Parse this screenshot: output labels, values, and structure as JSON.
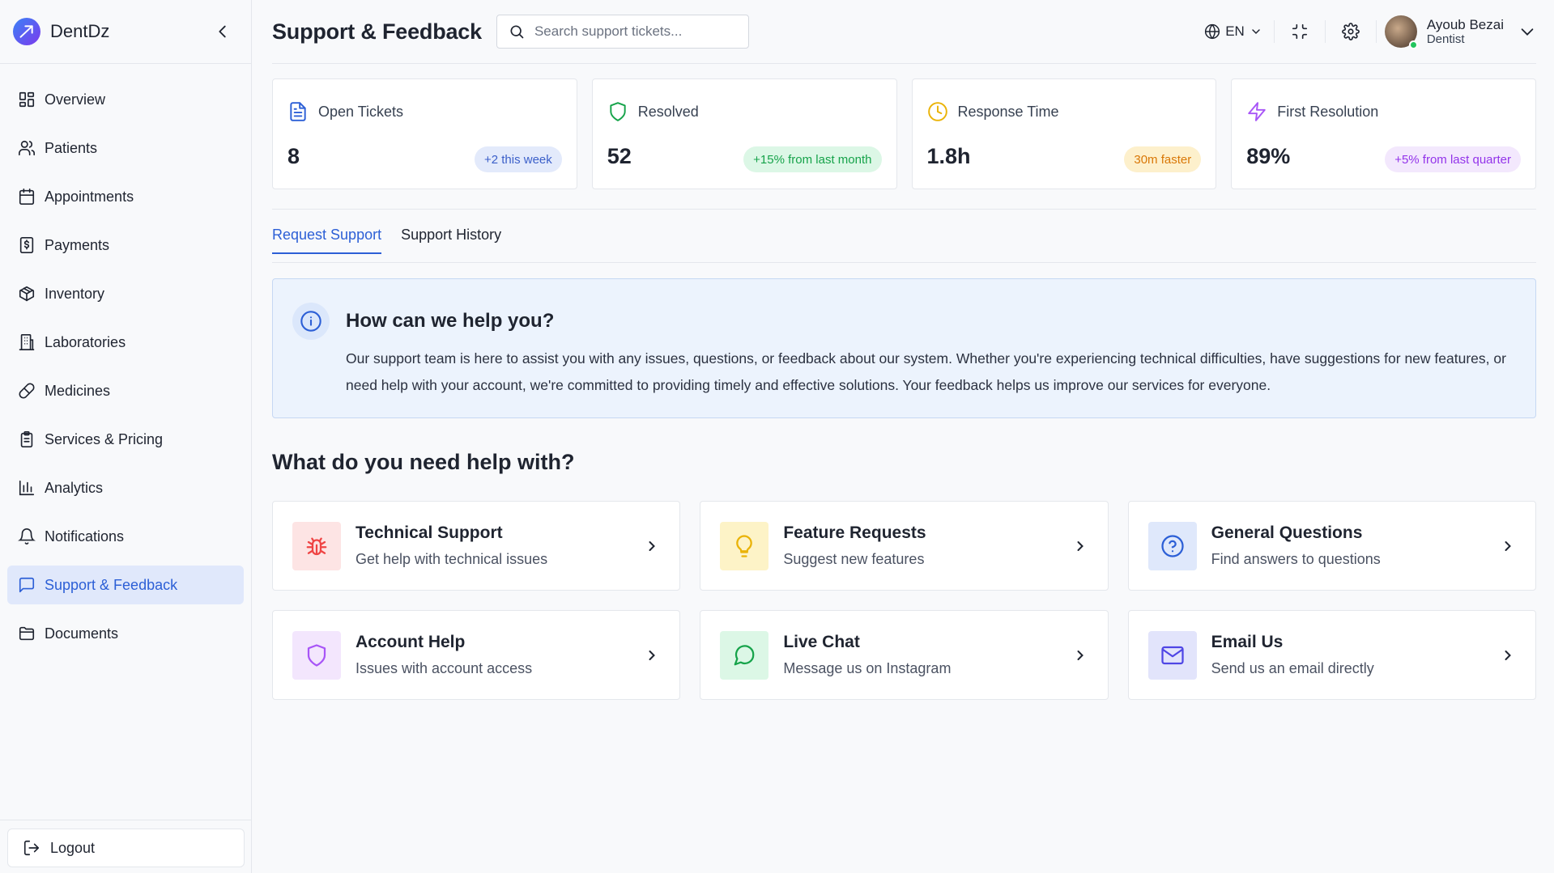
{
  "brand": {
    "name": "DentDz"
  },
  "sidebar": {
    "items": [
      {
        "label": "Overview",
        "icon": "grid-icon"
      },
      {
        "label": "Patients",
        "icon": "users-icon"
      },
      {
        "label": "Appointments",
        "icon": "calendar-icon"
      },
      {
        "label": "Payments",
        "icon": "dollar-receipt-icon"
      },
      {
        "label": "Inventory",
        "icon": "box-icon"
      },
      {
        "label": "Laboratories",
        "icon": "building-icon"
      },
      {
        "label": "Medicines",
        "icon": "pill-icon"
      },
      {
        "label": "Services & Pricing",
        "icon": "clipboard-icon"
      },
      {
        "label": "Analytics",
        "icon": "bar-chart-icon"
      },
      {
        "label": "Notifications",
        "icon": "bell-icon"
      },
      {
        "label": "Support & Feedback",
        "icon": "message-square-icon",
        "active": true
      },
      {
        "label": "Documents",
        "icon": "folder-icon"
      }
    ],
    "logout_label": "Logout"
  },
  "header": {
    "title": "Support & Feedback",
    "search_placeholder": "Search support tickets...",
    "language": "EN",
    "user": {
      "name": "Ayoub Bezai",
      "role": "Dentist",
      "status": "online"
    }
  },
  "stats": [
    {
      "label": "Open Tickets",
      "value": "8",
      "badge": "+2 this week",
      "icon": "file-text-icon",
      "color": "#2c5fd6",
      "badge_bg": "#e3eafb",
      "badge_fg": "#3b5fc9"
    },
    {
      "label": "Resolved",
      "value": "52",
      "badge": "+15% from last month",
      "icon": "shield-icon",
      "color": "#16a34a",
      "badge_bg": "#dcf7e6",
      "badge_fg": "#16a34a"
    },
    {
      "label": "Response Time",
      "value": "1.8h",
      "badge": "30m faster",
      "icon": "clock-icon",
      "color": "#eab308",
      "badge_bg": "#fdf0cc",
      "badge_fg": "#d97706"
    },
    {
      "label": "First Resolution",
      "value": "89%",
      "badge": "+5% from last quarter",
      "icon": "zap-icon",
      "color": "#a855f7",
      "badge_bg": "#f3e8fd",
      "badge_fg": "#9333ea"
    }
  ],
  "tabs": [
    {
      "label": "Request Support",
      "active": true
    },
    {
      "label": "Support History",
      "active": false
    }
  ],
  "info": {
    "title": "How can we help you?",
    "body": "Our support team is here to assist you with any issues, questions, or feedback about our system. Whether you're experiencing technical difficulties, have suggestions for new features, or need help with your account, we're committed to providing timely and effective solutions. Your feedback helps us improve our services for everyone."
  },
  "help": {
    "title": "What do you need help with?",
    "cards": [
      {
        "title": "Technical Support",
        "desc": "Get help with technical issues",
        "icon": "bug-icon",
        "color": "#ef4444",
        "bg": "#fde4e4"
      },
      {
        "title": "Feature Requests",
        "desc": "Suggest new features",
        "icon": "lightbulb-icon",
        "color": "#eab308",
        "bg": "#fdf3c7"
      },
      {
        "title": "General Questions",
        "desc": "Find answers to questions",
        "icon": "help-circle-icon",
        "color": "#2c5fd6",
        "bg": "#dfe8fb"
      },
      {
        "title": "Account Help",
        "desc": "Issues with account access",
        "icon": "shield-icon",
        "color": "#a855f7",
        "bg": "#f3e6fd"
      },
      {
        "title": "Live Chat",
        "desc": "Message us on Instagram",
        "icon": "message-circle-icon",
        "color": "#16a34a",
        "bg": "#dcf7e6"
      },
      {
        "title": "Email Us",
        "desc": "Send us an email directly",
        "icon": "mail-icon",
        "color": "#4f46e5",
        "bg": "#e2e4fb"
      }
    ]
  }
}
